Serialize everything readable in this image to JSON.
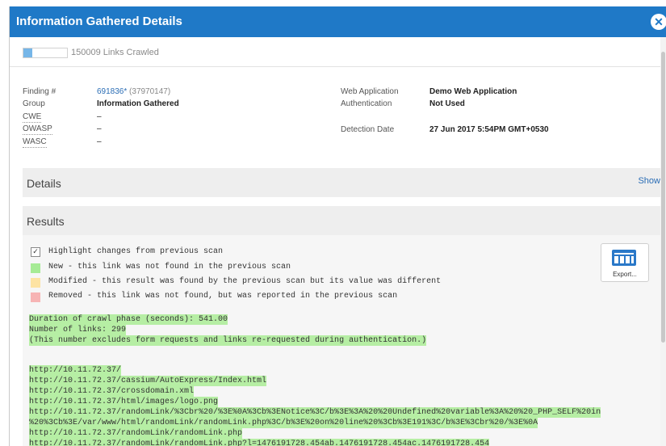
{
  "dialog": {
    "title": "Information Gathered Details",
    "close_label": "✕"
  },
  "progress": {
    "label": "150009 Links Crawled",
    "fraction": 0.2
  },
  "finding": {
    "finding_label": "Finding #",
    "finding_id": "691836*",
    "finding_sub": "(37970147)",
    "group_label": "Group",
    "group_value": "Information Gathered",
    "cwe_label": "CWE",
    "cwe_value": "–",
    "owasp_label": "OWASP",
    "owasp_value": "–",
    "wasc_label": "WASC",
    "wasc_value": "–",
    "webapp_label": "Web Application",
    "webapp_value": "Demo Web Application",
    "auth_label": "Authentication",
    "auth_value": "Not Used",
    "date_label": "Detection Date",
    "date_value": "27 Jun 2017 5:54PM GMT+0530"
  },
  "details": {
    "title": "Details",
    "show_label": "Show"
  },
  "results": {
    "title": "Results",
    "highlight_label": "Highlight changes from previous scan",
    "highlight_checked": "✓",
    "legend": [
      {
        "color": "#a6eb95",
        "text": "New - this link was not found in the previous scan"
      },
      {
        "color": "#fde3a3",
        "text": "Modified - this result was found by the previous scan but its value was different"
      },
      {
        "color": "#f7b4b4",
        "text": "Removed - this link was not found, but was reported in the previous scan"
      }
    ],
    "export_label": "Export...",
    "summary": [
      "Duration of crawl phase (seconds): 541.00",
      "Number of links: 299",
      "(This number excludes form requests and links re-requested during authentication.)"
    ],
    "links": [
      "http://10.11.72.37/",
      "http://10.11.72.37/cassium/AutoExpress/Index.html",
      "http://10.11.72.37/crossdomain.xml",
      "http://10.11.72.37/html/images/logo.png",
      "http://10.11.72.37/randomLink/%3Cbr%20/%3E%0A%3Cb%3ENotice%3C/b%3E%3A%20%20Undefined%20variable%3A%20%20_PHP_SELF%20in",
      "%20%3Cb%3E/var/www/html/randomLink/randomLink.php%3C/b%3E%20on%20line%20%3Cb%3E191%3C/b%3E%3Cbr%20/%3E%0A",
      "http://10.11.72.37/randomLink/randomLink.php",
      "http://10.11.72.37/randomLink/randomLink.php?l=1476191728.454ab.1476191728.454ac.1476191728.454"
    ]
  },
  "colors": {
    "title_bar": "#1f79c7",
    "link": "#2a6db5",
    "highlight_new": "#b6eea4"
  }
}
